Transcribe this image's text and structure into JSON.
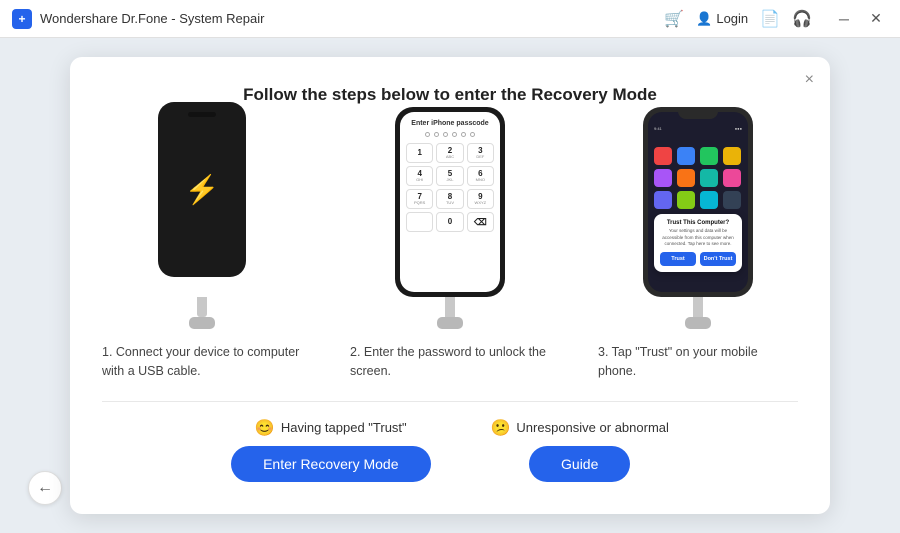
{
  "titlebar": {
    "app_name": "Wondershare Dr.Fone - System Repair",
    "login_label": "Login"
  },
  "dialog": {
    "close_label": "×",
    "title": "Follow the steps below to enter the Recovery Mode",
    "steps": [
      {
        "id": 1,
        "caption": "1. Connect your device to computer with a USB cable."
      },
      {
        "id": 2,
        "caption": "2. Enter the password to unlock the screen."
      },
      {
        "id": 3,
        "caption": "3. Tap \"Trust\" on your mobile phone."
      }
    ],
    "passcode_title": "Enter iPhone passcode",
    "trust_title": "Trust This Computer?",
    "trust_body": "Your settings and data will be accessible from this computer when connected. Tap here to see more.",
    "trust_label": "Trust",
    "dont_trust_label": "Don't Trust",
    "action1_label": "Having tapped \"Trust\"",
    "action1_btn": "Enter Recovery Mode",
    "action2_label": "Unresponsive or abnormal",
    "action2_btn": "Guide",
    "keypad": [
      "1",
      "2",
      "3",
      "4",
      "5",
      "6",
      "7",
      "8",
      "9",
      "0"
    ],
    "keypad_sub": [
      "",
      "ABC",
      "DEF",
      "GHI",
      "JKL",
      "MNO",
      "PQRS",
      "TUV",
      "WXYZ",
      ""
    ]
  },
  "back_button": "‹"
}
